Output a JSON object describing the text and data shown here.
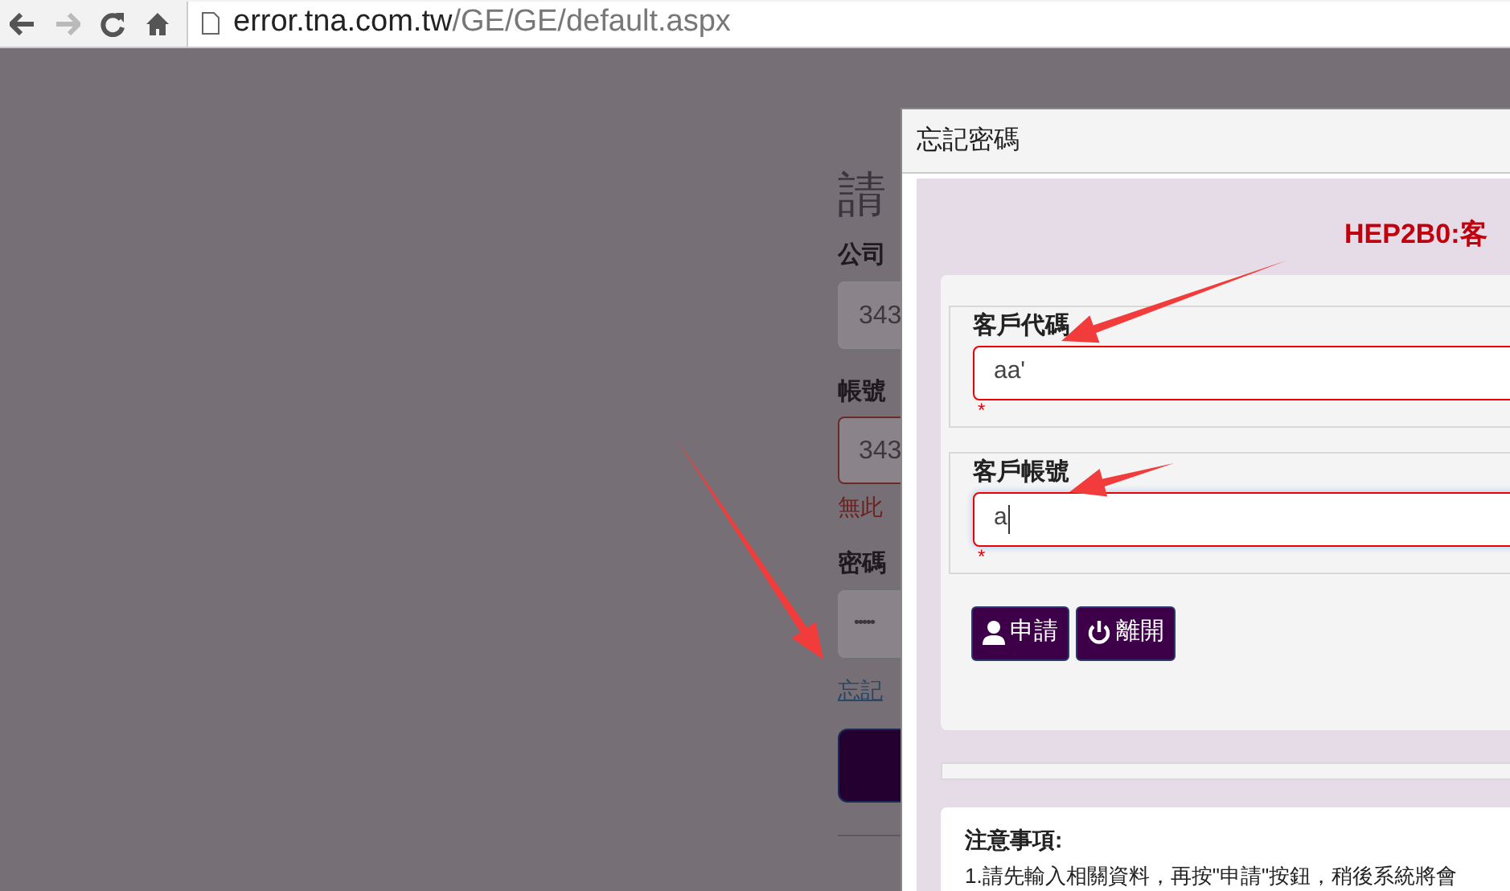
{
  "browser": {
    "back_disabled": false,
    "forward_disabled": true,
    "url_host": "error.tna.com.tw",
    "url_path": "/GE/GE/default.aspx"
  },
  "login_page": {
    "title": "請",
    "company_label": "公司",
    "company_value": "343",
    "account_label": "帳號",
    "account_value": "343",
    "account_error": "無此",
    "password_label": "密碼",
    "password_value": "•••••",
    "forgot_link": "忘記"
  },
  "modal": {
    "title": "忘記密碼",
    "message": "HEP2B0:客",
    "fields": [
      {
        "label": "客戶代碼",
        "value": "aa'",
        "required_mark": "*"
      },
      {
        "label": "客戶帳號",
        "value": "a",
        "required_mark": "*"
      }
    ],
    "buttons": [
      {
        "kind": "apply",
        "label": "申請"
      },
      {
        "kind": "exit",
        "label": "離開"
      }
    ],
    "notes": {
      "title": "注意事項:",
      "text": "1.請先輸入相關資料，再按\"申請\"按鈕，稍後系統將會"
    }
  }
}
